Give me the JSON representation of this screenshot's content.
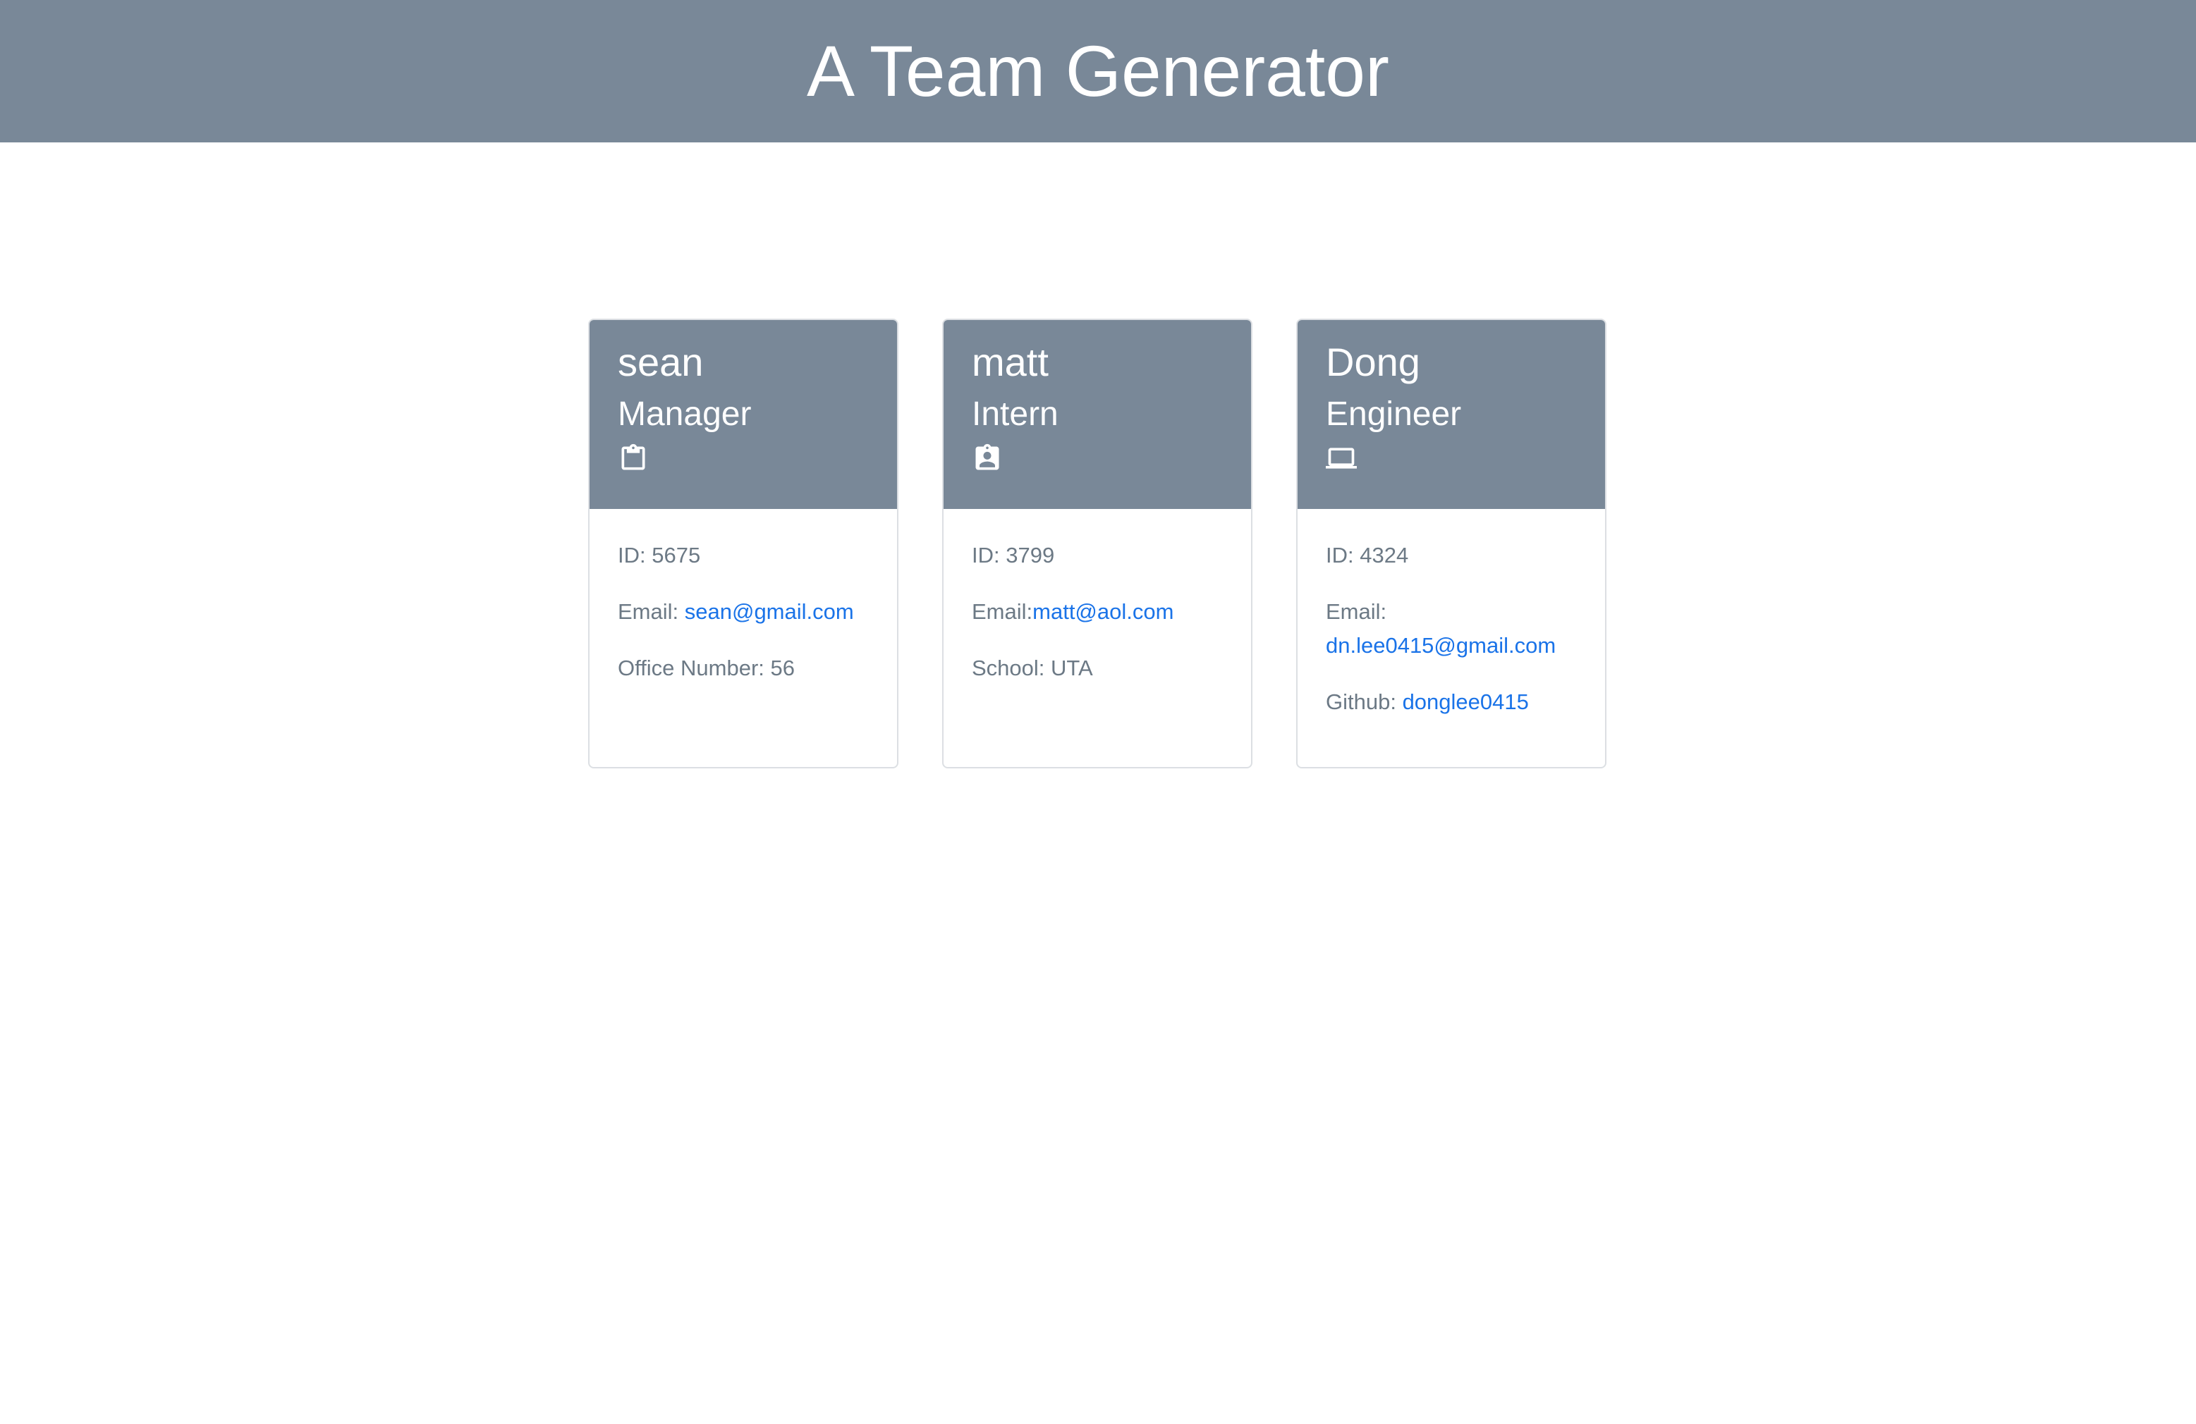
{
  "header": {
    "title": "A Team Generator"
  },
  "cards": [
    {
      "name": "sean",
      "role": "Manager",
      "icon": "clipboard-icon",
      "id_label": "ID: 5675",
      "email_label": "Email: ",
      "email": "sean@gmail.com",
      "extra_label": "Office Number: 56",
      "extra_link": ""
    },
    {
      "name": "matt",
      "role": "Intern",
      "icon": "assignment-ind-icon",
      "id_label": "ID: 3799",
      "email_label": "Email:",
      "email": "matt@aol.com",
      "extra_label": "School: UTA",
      "extra_link": ""
    },
    {
      "name": "Dong",
      "role": "Engineer",
      "icon": "laptop-icon",
      "id_label": "ID: 4324",
      "email_label": "Email:",
      "email": "dn.lee0415@gmail.com",
      "extra_label": "Github: ",
      "extra_link": "donglee0415"
    }
  ],
  "colors": {
    "header_bg": "#798898",
    "link": "#1a73e8",
    "body_text": "#6c7985"
  }
}
